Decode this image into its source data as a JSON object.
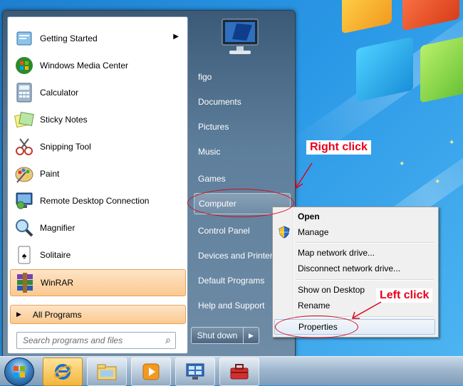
{
  "programs": [
    {
      "label": "Getting Started",
      "icon": "getting-started-icon",
      "has_submenu": true
    },
    {
      "label": "Windows Media Center",
      "icon": "media-center-icon"
    },
    {
      "label": "Calculator",
      "icon": "calculator-icon"
    },
    {
      "label": "Sticky Notes",
      "icon": "sticky-notes-icon"
    },
    {
      "label": "Snipping Tool",
      "icon": "snipping-tool-icon"
    },
    {
      "label": "Paint",
      "icon": "paint-icon"
    },
    {
      "label": "Remote Desktop Connection",
      "icon": "remote-desktop-icon"
    },
    {
      "label": "Magnifier",
      "icon": "magnifier-icon"
    },
    {
      "label": "Solitaire",
      "icon": "solitaire-icon"
    },
    {
      "label": "WinRAR",
      "icon": "winrar-icon",
      "highlighted": true
    }
  ],
  "all_programs_label": "All Programs",
  "search_placeholder": "Search programs and files",
  "right_items": [
    {
      "label": "figo"
    },
    {
      "label": "Documents"
    },
    {
      "label": "Pictures"
    },
    {
      "label": "Music"
    },
    {
      "label": "Games"
    },
    {
      "label": "Computer",
      "selected": true
    },
    {
      "label": "Control Panel"
    },
    {
      "label": "Devices and Printers"
    },
    {
      "label": "Default Programs"
    },
    {
      "label": "Help and Support"
    }
  ],
  "shutdown_label": "Shut down",
  "context_menu": {
    "items": [
      {
        "label": "Open",
        "bold": true
      },
      {
        "label": "Manage",
        "icon": "shield-icon"
      },
      {
        "label": "Map network drive..."
      },
      {
        "label": "Disconnect network drive..."
      },
      {
        "label": "Show on Desktop"
      },
      {
        "label": "Rename"
      },
      {
        "label": "Properties",
        "hover": true
      }
    ]
  },
  "annotations": {
    "right_click": "Right click",
    "left_click": "Left click",
    "color": "#e8001c"
  },
  "taskbar": {
    "buttons": [
      "start-orb",
      "internet-explorer-icon",
      "windows-explorer-icon",
      "media-player-icon",
      "network-app-icon",
      "toolbox-app-icon"
    ]
  }
}
